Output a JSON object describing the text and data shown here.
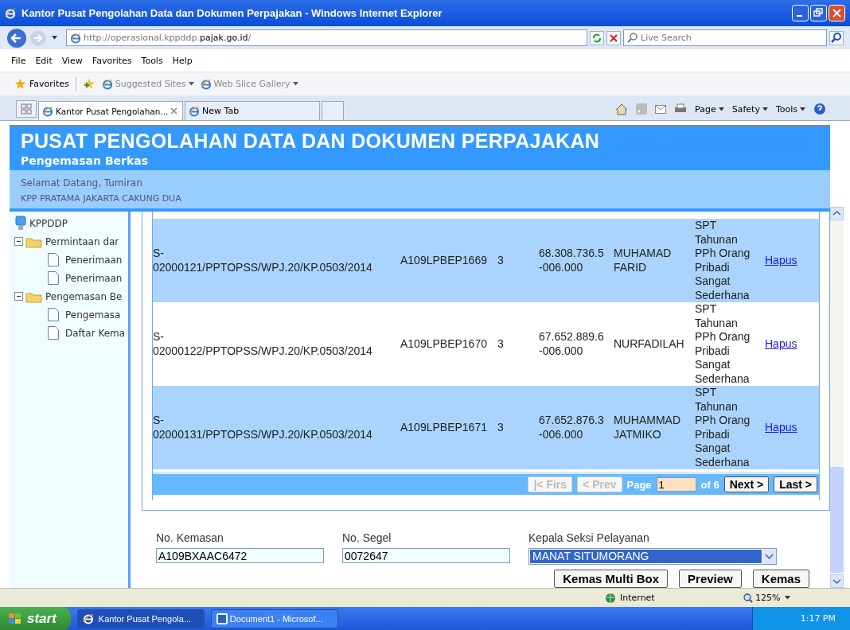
{
  "window": {
    "title": "Kantor Pusat Pengolahan Data dan Dokumen Perpajakan - Windows Internet Explorer"
  },
  "address": {
    "prefix": "http://operasional.kppddp.",
    "host": "pajak.go.id",
    "suffix": "/"
  },
  "search": {
    "placeholder": "Live Search"
  },
  "menu": [
    "File",
    "Edit",
    "View",
    "Favorites",
    "Tools",
    "Help"
  ],
  "favorites_bar": {
    "label": "Favorites",
    "links": [
      "Suggested Sites",
      "Web Slice Gallery"
    ]
  },
  "tabs": [
    {
      "label": "Kantor Pusat Pengolahan...",
      "selected": true
    },
    {
      "label": "New Tab",
      "selected": false
    }
  ],
  "command_bar": [
    "Page",
    "Safety",
    "Tools"
  ],
  "header": {
    "title": "PUSAT PENGOLAHAN DATA DAN DOKUMEN PERPAJAKAN",
    "subtitle": "Pengemasan Berkas",
    "welcome": "Selamat Datang, Tumiran",
    "office": "KPP PRATAMA JAKARTA CAKUNG DUA"
  },
  "tree": {
    "label": "KPPDDP",
    "children": [
      {
        "label": "Permintaan dar",
        "expanded": true,
        "children": [
          {
            "label": "Penerimaan"
          },
          {
            "label": "Penerimaan"
          }
        ]
      },
      {
        "label": "Pengemasan Be",
        "expanded": true,
        "children": [
          {
            "label": "Pengemasa"
          },
          {
            "label": "Daftar Kema"
          }
        ]
      }
    ]
  },
  "table": {
    "rows": [
      {
        "nomor": "S-02000121/PPTOPSS/WPJ.20/KP.0503/2014",
        "kode": "A109LPBEP1669",
        "jumlah": "3",
        "npwp": "68.308.736.5-006.000",
        "nama": "MUHAMAD FARID",
        "jenis": "SPT Tahunan PPh Orang Pribadi Sangat Sederhana",
        "action": "Hapus"
      },
      {
        "nomor": "S-02000122/PPTOPSS/WPJ.20/KP.0503/2014",
        "kode": "A109LPBEP1670",
        "jumlah": "3",
        "npwp": "67.652.889.6-006.000",
        "nama": "NURFADILAH",
        "jenis": "SPT Tahunan PPh Orang Pribadi Sangat Sederhana",
        "action": "Hapus"
      },
      {
        "nomor": "S-02000131/PPTOPSS/WPJ.20/KP.0503/2014",
        "kode": "A109LPBEP1671",
        "jumlah": "3",
        "npwp": "67.652.876.3-006.000",
        "nama": "MUHAMMAD JATMIKO",
        "jenis": "SPT Tahunan PPh Orang Pribadi Sangat Sederhana",
        "action": "Hapus"
      }
    ]
  },
  "pager": {
    "first": {
      "label": "|< Firs",
      "disabled": true
    },
    "prev": {
      "label": "< Prev",
      "disabled": true
    },
    "page_label": "Page",
    "page": "1",
    "of": "of 6",
    "next": {
      "label": "Next >",
      "disabled": false
    },
    "last": {
      "label": "Last >",
      "disabled": false
    }
  },
  "form": [
    {
      "label": "No. Kemasan",
      "kind": "text",
      "value": "A109BXAAC6472"
    },
    {
      "label": "No. Segel",
      "kind": "text",
      "value": "0072647"
    },
    {
      "label": "Kepala Seksi Pelayanan",
      "kind": "select",
      "value": "MANAT SITUMORANG"
    }
  ],
  "buttons": [
    "Kemas Multi Box",
    "Preview",
    "Kemas"
  ],
  "status_bar": {
    "zone": "Internet",
    "zoom": "125%"
  },
  "taskbar": {
    "start": "start",
    "items": [
      "Kantor Pusat Pengola...",
      "Document1 - Microsof..."
    ],
    "time": "1:17 PM"
  }
}
